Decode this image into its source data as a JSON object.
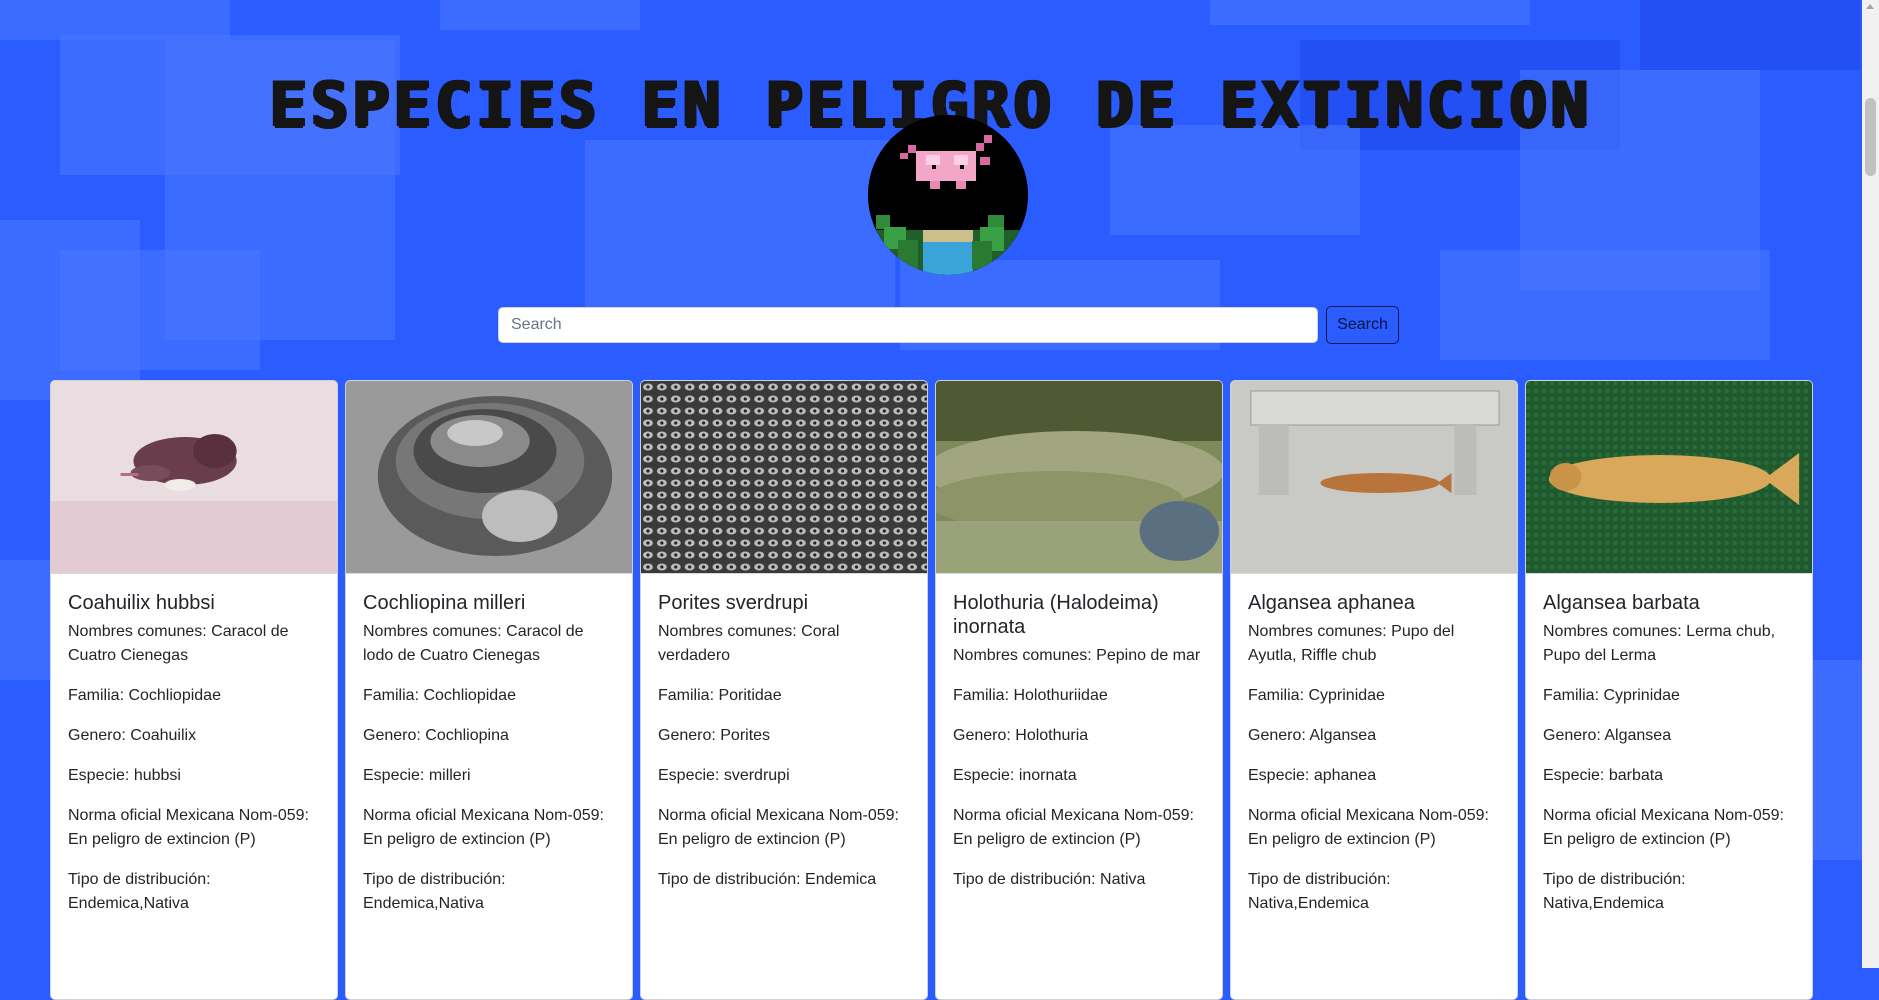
{
  "title": "ESPECIES EN PELIGRO DE EXTINCION",
  "search": {
    "placeholder": "Search",
    "button_label": "Search"
  },
  "species": [
    {
      "name": "Coahuilix hubbsi",
      "nombres": "Nombres comunes: Caracol de Cuatro Cienegas",
      "familia": "Familia: Cochliopidae",
      "genero": "Genero: Coahuilix",
      "especie": "Especie: hubbsi",
      "norma": "Norma oficial Mexicana Nom-059: En peligro de extincion (P)",
      "distribucion": "Tipo de distribución: Endemica,Nativa"
    },
    {
      "name": "Cochliopina milleri",
      "nombres": "Nombres comunes: Caracol de lodo de Cuatro Cienegas",
      "familia": "Familia: Cochliopidae",
      "genero": "Genero: Cochliopina",
      "especie": "Especie: milleri",
      "norma": "Norma oficial Mexicana Nom-059: En peligro de extincion (P)",
      "distribucion": "Tipo de distribución: Endemica,Nativa"
    },
    {
      "name": "Porites sverdrupi",
      "nombres": "Nombres comunes: Coral verdadero",
      "familia": "Familia: Poritidae",
      "genero": "Genero: Porites",
      "especie": "Especie: sverdrupi",
      "norma": "Norma oficial Mexicana Nom-059: En peligro de extincion (P)",
      "distribucion": "Tipo de distribución: Endemica"
    },
    {
      "name": "Holothuria (Halodeima) inornata",
      "nombres": "Nombres comunes: Pepino de mar",
      "familia": "Familia: Holothuriidae",
      "genero": "Genero: Holothuria",
      "especie": "Especie: inornata",
      "norma": "Norma oficial Mexicana Nom-059: En peligro de extincion (P)",
      "distribucion": "Tipo de distribución: Nativa"
    },
    {
      "name": "Algansea aphanea",
      "nombres": "Nombres comunes: Pupo del Ayutla, Riffle chub",
      "familia": "Familia: Cyprinidae",
      "genero": "Genero: Algansea",
      "especie": "Especie: aphanea",
      "norma": "Norma oficial Mexicana Nom-059: En peligro de extincion (P)",
      "distribucion": "Tipo de distribución: Nativa,Endemica"
    },
    {
      "name": "Algansea barbata",
      "nombres": "Nombres comunes: Lerma chub, Pupo del Lerma",
      "familia": "Familia: Cyprinidae",
      "genero": "Genero: Algansea",
      "especie": "Especie: barbata",
      "norma": "Norma oficial Mexicana Nom-059: En peligro de extincion (P)",
      "distribucion": "Tipo de distribución: Nativa,Endemica"
    }
  ],
  "colors": {
    "background": "#2b5cff",
    "title": "#151515",
    "button_border": "#0d1b4a"
  }
}
